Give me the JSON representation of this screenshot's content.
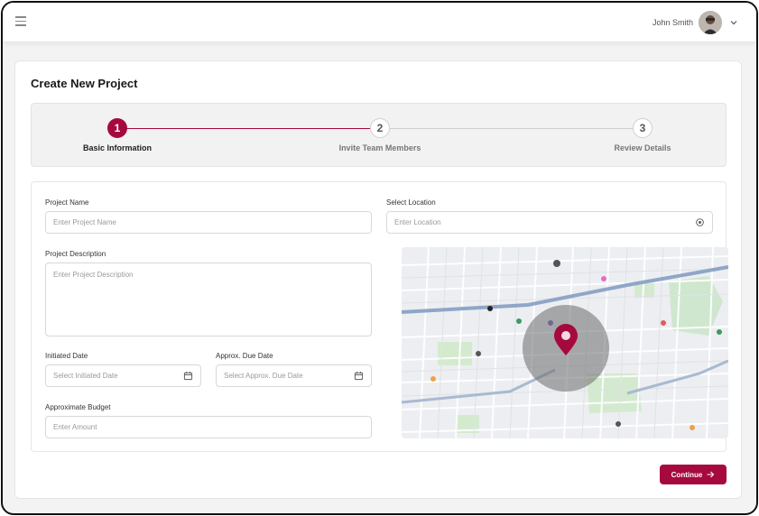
{
  "header": {
    "user_name": "John Smith"
  },
  "page": {
    "title": "Create New Project"
  },
  "stepper": {
    "steps": [
      {
        "number": "1",
        "label": "Basic Information",
        "state": "active"
      },
      {
        "number": "2",
        "label": "Invite Team Members",
        "state": "idle"
      },
      {
        "number": "3",
        "label": "Review Details",
        "state": "idle"
      }
    ]
  },
  "form": {
    "project_name": {
      "label": "Project Name",
      "placeholder": "Enter Project Name",
      "value": ""
    },
    "location": {
      "label": "Select Location",
      "placeholder": "Enter Location",
      "value": ""
    },
    "description": {
      "label": "Project Description",
      "placeholder": "Enter Project Description",
      "value": ""
    },
    "initiated_date": {
      "label": "Initiated Date",
      "placeholder": "Select Initiated Date",
      "value": ""
    },
    "due_date": {
      "label": "Approx. Due Date",
      "placeholder": "Select Approx. Due Date",
      "value": ""
    },
    "budget": {
      "label": "Approximate Budget",
      "placeholder": "Enter Amount",
      "value": ""
    }
  },
  "actions": {
    "continue_label": "Continue"
  },
  "colors": {
    "accent": "#a6093d",
    "map_park": "#cfe7cf",
    "map_water_road": "#8fa6c7"
  },
  "icons": [
    "menu-icon",
    "avatar",
    "chevron-down-icon",
    "location-target-icon",
    "calendar-icon",
    "map-pin-icon",
    "arrow-right-icon"
  ]
}
